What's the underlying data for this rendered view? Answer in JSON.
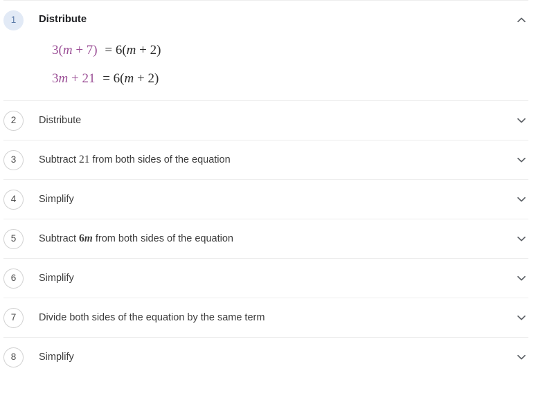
{
  "panel": {
    "title": "equation-solution-steps"
  },
  "colors": {
    "highlight": "#9b4f96",
    "equation_text": "#2b2b2b",
    "active_badge_bg": "#e2eaf6",
    "active_badge_text": "#5c7ba8",
    "badge_border": "#d2d2d2",
    "badge_text": "#4a4a4a",
    "divider": "#ededed",
    "chevron": "#5f6368",
    "label_text": "#3c3c3c"
  },
  "steps": [
    {
      "number": "1",
      "label": "Distribute",
      "state": "expanded",
      "chevron_icon": "chevron-up-icon",
      "equations": [
        {
          "highlighted": "3(m + 7)",
          "rest": "= 6(m + 2)",
          "hl_parts": [
            "3(",
            "m",
            " + 7)"
          ],
          "rest_parts": [
            "= 6(",
            "m",
            " + 2)"
          ]
        },
        {
          "highlighted": "3m + 21",
          "rest": "= 6(m + 2)",
          "hl_parts": [
            "3",
            "m",
            " + 21"
          ],
          "rest_parts": [
            "= 6(",
            "m",
            " + 2)"
          ]
        }
      ]
    },
    {
      "number": "2",
      "label": "Distribute",
      "state": "collapsed",
      "chevron_icon": "chevron-down-icon"
    },
    {
      "number": "3",
      "label_pre": "Subtract ",
      "label_math": "21",
      "label_post": " from both sides of the equation",
      "label": "Subtract 21 from both sides of the equation",
      "state": "collapsed",
      "chevron_icon": "chevron-down-icon"
    },
    {
      "number": "4",
      "label": "Simplify",
      "state": "collapsed",
      "chevron_icon": "chevron-down-icon"
    },
    {
      "number": "5",
      "label_pre": "Subtract ",
      "label_math_num": "6",
      "label_math_var": "m",
      "label_post": " from both sides of the equation",
      "label": "Subtract 6m from both sides of the equation",
      "state": "collapsed",
      "chevron_icon": "chevron-down-icon"
    },
    {
      "number": "6",
      "label": "Simplify",
      "state": "collapsed",
      "chevron_icon": "chevron-down-icon"
    },
    {
      "number": "7",
      "label": "Divide both sides of the equation by the same term",
      "state": "collapsed",
      "chevron_icon": "chevron-down-icon"
    },
    {
      "number": "8",
      "label": "Simplify",
      "state": "collapsed",
      "chevron_icon": "chevron-down-icon"
    }
  ]
}
